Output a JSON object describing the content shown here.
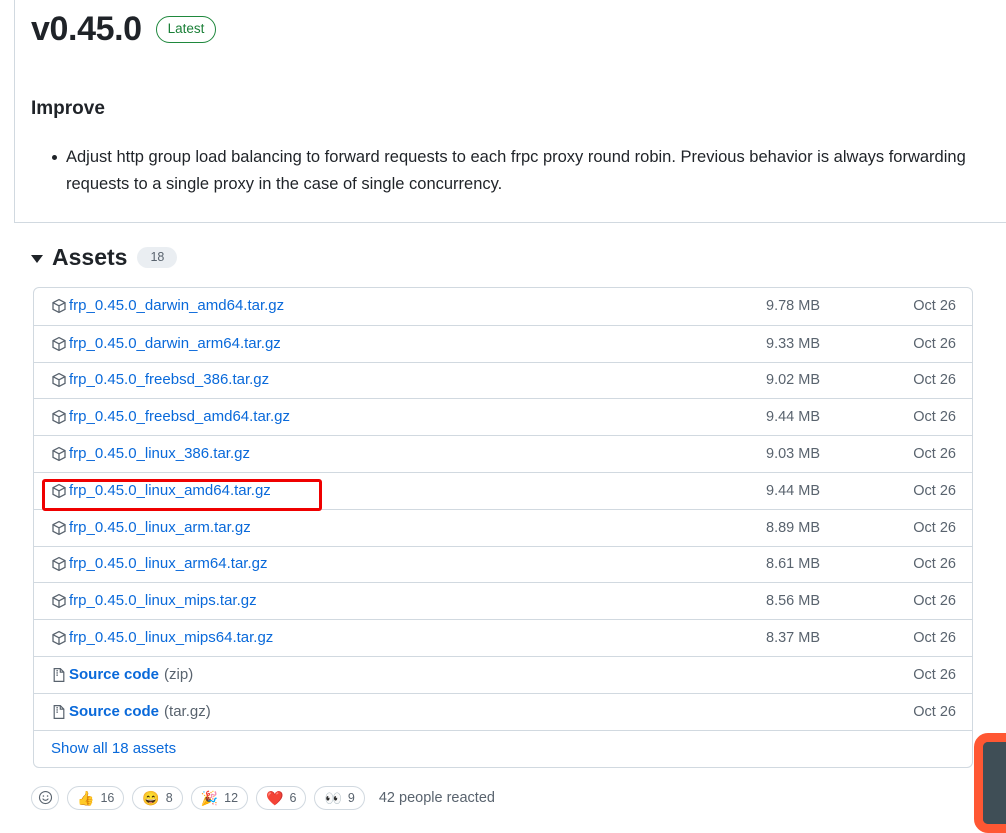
{
  "release": {
    "version": "v0.45.0",
    "badge": "Latest",
    "notes_heading": "Improve",
    "notes_items": [
      "Adjust http group load balancing to forward requests to each frpc proxy round robin. Previous behavior is always forwarding requests to a single proxy in the case of single concurrency."
    ]
  },
  "assets": {
    "title": "Assets",
    "count": "18",
    "show_all_label": "Show all 18 assets",
    "rows": [
      {
        "icon": "package-icon",
        "name": "frp_0.45.0_darwin_amd64.tar.gz",
        "suffix": "",
        "size": "9.78 MB",
        "date": "Oct 26",
        "bold": false,
        "highlighted": false
      },
      {
        "icon": "package-icon",
        "name": "frp_0.45.0_darwin_arm64.tar.gz",
        "suffix": "",
        "size": "9.33 MB",
        "date": "Oct 26",
        "bold": false,
        "highlighted": false
      },
      {
        "icon": "package-icon",
        "name": "frp_0.45.0_freebsd_386.tar.gz",
        "suffix": "",
        "size": "9.02 MB",
        "date": "Oct 26",
        "bold": false,
        "highlighted": false
      },
      {
        "icon": "package-icon",
        "name": "frp_0.45.0_freebsd_amd64.tar.gz",
        "suffix": "",
        "size": "9.44 MB",
        "date": "Oct 26",
        "bold": false,
        "highlighted": false
      },
      {
        "icon": "package-icon",
        "name": "frp_0.45.0_linux_386.tar.gz",
        "suffix": "",
        "size": "9.03 MB",
        "date": "Oct 26",
        "bold": false,
        "highlighted": false
      },
      {
        "icon": "package-icon",
        "name": "frp_0.45.0_linux_amd64.tar.gz",
        "suffix": "",
        "size": "9.44 MB",
        "date": "Oct 26",
        "bold": false,
        "highlighted": true
      },
      {
        "icon": "package-icon",
        "name": "frp_0.45.0_linux_arm.tar.gz",
        "suffix": "",
        "size": "8.89 MB",
        "date": "Oct 26",
        "bold": false,
        "highlighted": false
      },
      {
        "icon": "package-icon",
        "name": "frp_0.45.0_linux_arm64.tar.gz",
        "suffix": "",
        "size": "8.61 MB",
        "date": "Oct 26",
        "bold": false,
        "highlighted": false
      },
      {
        "icon": "package-icon",
        "name": "frp_0.45.0_linux_mips.tar.gz",
        "suffix": "",
        "size": "8.56 MB",
        "date": "Oct 26",
        "bold": false,
        "highlighted": false
      },
      {
        "icon": "package-icon",
        "name": "frp_0.45.0_linux_mips64.tar.gz",
        "suffix": "",
        "size": "8.37 MB",
        "date": "Oct 26",
        "bold": false,
        "highlighted": false
      },
      {
        "icon": "file-zip-icon",
        "name": "Source code",
        "suffix": "(zip)",
        "size": "",
        "date": "Oct 26",
        "bold": true,
        "highlighted": false
      },
      {
        "icon": "file-zip-icon",
        "name": "Source code",
        "suffix": "(tar.gz)",
        "size": "",
        "date": "Oct 26",
        "bold": true,
        "highlighted": false
      }
    ]
  },
  "reactions": {
    "add_label": "smiley-add-icon",
    "items": [
      {
        "emoji": "👍",
        "name": "thumbs-up",
        "count": "16"
      },
      {
        "emoji": "😄",
        "name": "laugh",
        "count": "8"
      },
      {
        "emoji": "🎉",
        "name": "hooray",
        "count": "12"
      },
      {
        "emoji": "❤️",
        "name": "heart",
        "count": "6"
      },
      {
        "emoji": "👀",
        "name": "eyes",
        "count": "9"
      }
    ],
    "summary": "42 people reacted"
  },
  "colors": {
    "link": "#0969da",
    "muted": "#59636e",
    "border": "#d1d9e0",
    "badge_green": "#1a7f37",
    "highlight_red": "#ef0000",
    "overlay_orange": "#ff5733",
    "overlay_dark": "#3f4e56"
  }
}
